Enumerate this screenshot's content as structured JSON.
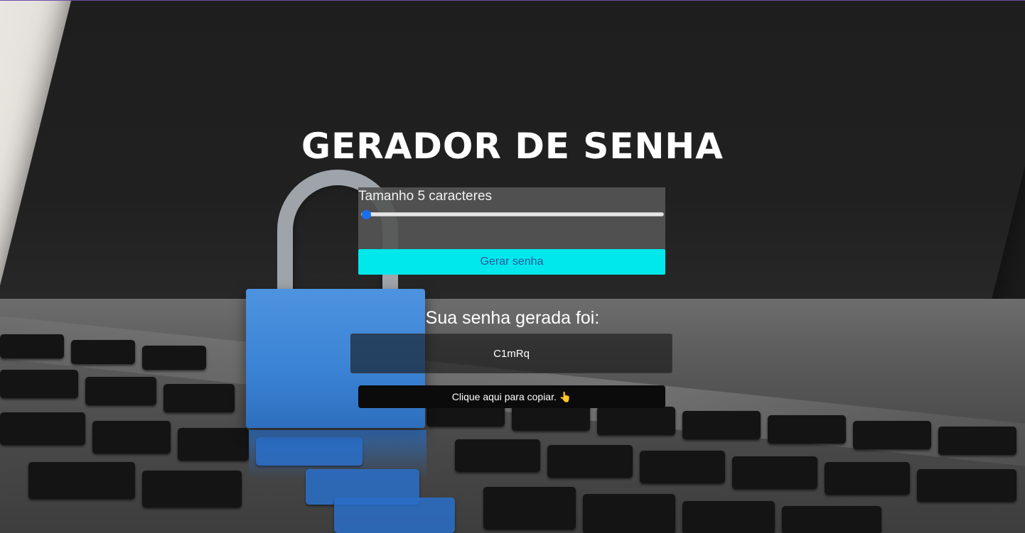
{
  "app": {
    "title": "GERADOR DE SENHA"
  },
  "generator": {
    "length_prefix": "Tamanho ",
    "length_value": "5",
    "length_suffix": " caracteres",
    "slider_level": 0.0,
    "generate_label": "Gerar senha"
  },
  "result": {
    "title": "Sua senha gerada foi:",
    "password": "C1mRq",
    "copy_label": "Clique aqui para copiar. 👆"
  },
  "colors": {
    "accent_button": "#00e8ec",
    "slider_thumb": "#1a6ef2",
    "copy_button": "#0b0b0b"
  }
}
